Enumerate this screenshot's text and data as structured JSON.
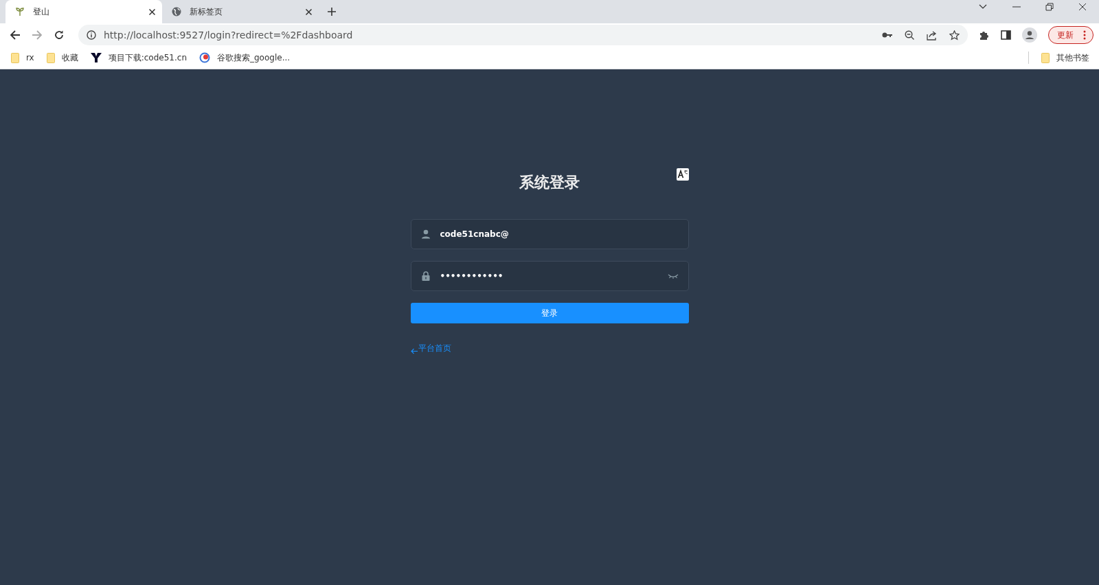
{
  "browser": {
    "tabs": [
      {
        "title": "登山",
        "selected": true
      },
      {
        "title": "新标签页",
        "selected": false
      }
    ],
    "address": "http://localhost:9527/login?redirect=%2Fdashboard",
    "update_button": "更新",
    "bookmarks": [
      {
        "label": "rx",
        "kind": "folder"
      },
      {
        "label": "收藏",
        "kind": "folder"
      },
      {
        "label": "项目下载:code51.cn",
        "kind": "y-site"
      },
      {
        "label": "谷歌搜索_google...",
        "kind": "search-site"
      }
    ],
    "other_bookmarks": "其他书签"
  },
  "login": {
    "title": "系统登录",
    "username": {
      "value": "code51cnabc@"
    },
    "password": {
      "value": "••••••••••••"
    },
    "submit": "登录",
    "back_link": "平台首页"
  }
}
